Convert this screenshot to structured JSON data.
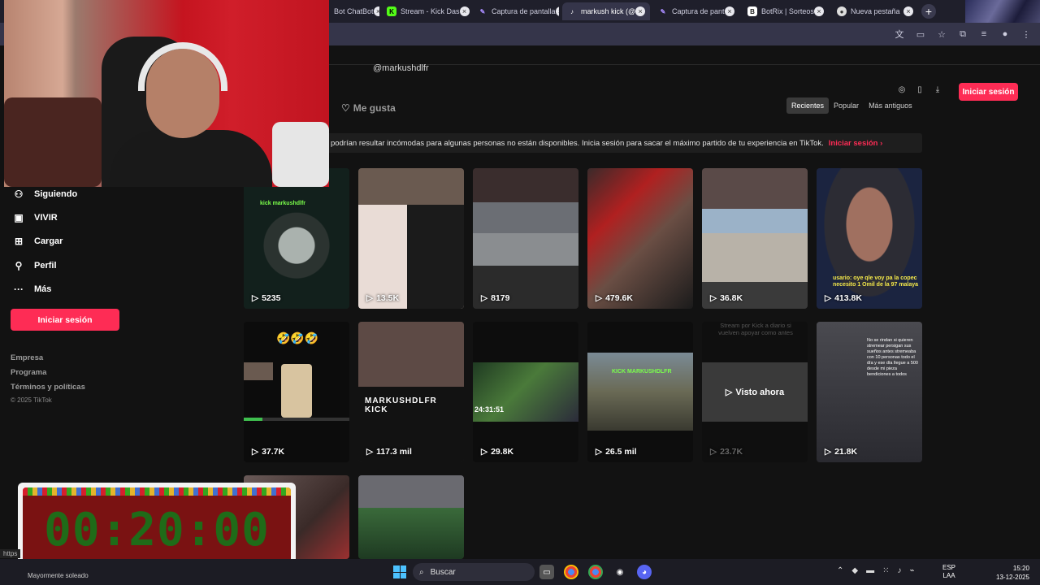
{
  "browser": {
    "tabs": [
      {
        "label": "Bot ChatBot",
        "icon": "chatbot-icon"
      },
      {
        "label": "Stream - Kick Das",
        "icon": "kick-icon"
      },
      {
        "label": "Captura de pantalla",
        "icon": "screenshot-icon"
      },
      {
        "label": "markush kick (@",
        "icon": "tiktok-icon"
      },
      {
        "label": "Captura de pant",
        "icon": "screenshot-icon"
      },
      {
        "label": "BotRix | Sorteos",
        "icon": "botrix-icon"
      },
      {
        "label": "Nueva pestaña",
        "icon": "chrome-icon"
      }
    ],
    "new_tab_label": "+"
  },
  "profile": {
    "handle": "@markushdlfr",
    "likes_tab": "Me gusta",
    "sort_options": [
      "Recientes",
      "Popular",
      "Más antiguos"
    ],
    "login_button": "Iniciar sesión",
    "banner_text": "podrían resultar incómodas para algunas personas no están disponibles. Inicia sesión para sacar el máximo partido de tu experiencia en TikTok.",
    "banner_link": "Iniciar sesión"
  },
  "sidebar": {
    "items": [
      {
        "label": "Siguiendo",
        "icon": "following-icon"
      },
      {
        "label": "VIVIR",
        "icon": "live-icon"
      },
      {
        "label": "Cargar",
        "icon": "upload-icon"
      },
      {
        "label": "Perfil",
        "icon": "profile-icon"
      },
      {
        "label": "Más",
        "icon": "more-icon"
      }
    ],
    "login_button": "Iniciar sesión",
    "footer": [
      "Empresa",
      "Programa",
      "Términos y políticas"
    ],
    "copyright": "© 2025 TikTok"
  },
  "videos": [
    {
      "views": "5235",
      "overlay": "kick markushdlfr"
    },
    {
      "views": "13.5K",
      "overlay": ""
    },
    {
      "views": "8179",
      "overlay": ""
    },
    {
      "views": "479.6K",
      "overlay": ""
    },
    {
      "views": "36.8K",
      "overlay": ""
    },
    {
      "views": "413.8K",
      "overlay": "usario: oye qle voy pa la copec necesito 1 Omil de la 97 malaya"
    },
    {
      "views": "37.7K",
      "overlay": "🤣🤣🤣"
    },
    {
      "views": "117.3 mil",
      "overlay": "MARKUSHDLFR KICK"
    },
    {
      "views": "29.8K",
      "duration": "24:31:51"
    },
    {
      "views": "26.5 mil",
      "overlay": "KICK MARKUSHDLFR"
    },
    {
      "views": "23.7K",
      "watched": "Visto ahora",
      "caption": "Stream por Kick a diario si vuelven apoyar como antes"
    },
    {
      "views": "21.8K",
      "overlay": "No se rindan si quieren stremear persigan sus sueños antes stremeaba con 10 personas todo el día y ese día llegue a 500 desde mi pieza bendiciones a todos"
    },
    {
      "views": "",
      "overlay": ""
    },
    {
      "views": "",
      "overlay": ""
    }
  ],
  "timer": {
    "value": "00:20:00"
  },
  "taskbar": {
    "search_placeholder": "Buscar",
    "weather": "Mayormente soleado",
    "lang_top": "ESP",
    "lang_bottom": "LAA",
    "time": "15:20",
    "date": "13-12-2025"
  },
  "status_url": "https"
}
